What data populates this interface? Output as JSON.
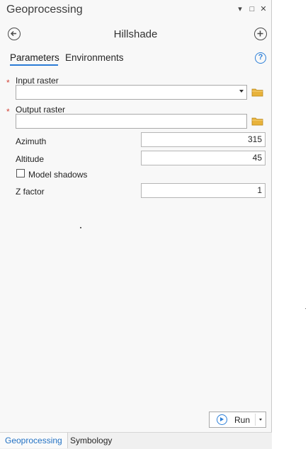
{
  "window": {
    "title": "Geoprocessing",
    "controls": {
      "menu": "▾",
      "restore": "□",
      "close": "✕"
    }
  },
  "tool": {
    "title": "Hillshade",
    "back_icon": "back-arrow-icon",
    "add_icon": "plus-icon"
  },
  "tabs": {
    "parameters": "Parameters",
    "environments": "Environments",
    "help": "?"
  },
  "params": {
    "input_raster": {
      "label": "Input raster",
      "required_mark": "*",
      "value": ""
    },
    "output_raster": {
      "label": "Output raster",
      "required_mark": "*",
      "value": ""
    },
    "azimuth": {
      "label": "Azimuth",
      "value": "315"
    },
    "altitude": {
      "label": "Altitude",
      "value": "45"
    },
    "model_shadows": {
      "label": "Model shadows",
      "checked": false
    },
    "z_factor": {
      "label": "Z factor",
      "value": "1"
    }
  },
  "run": {
    "label": "Run"
  },
  "bottom_tabs": {
    "geoprocessing": "Geoprocessing",
    "symbology": "Symbology"
  },
  "colors": {
    "accent": "#2c7fd8",
    "required": "#d2453a",
    "folder": "#e8b23a"
  }
}
